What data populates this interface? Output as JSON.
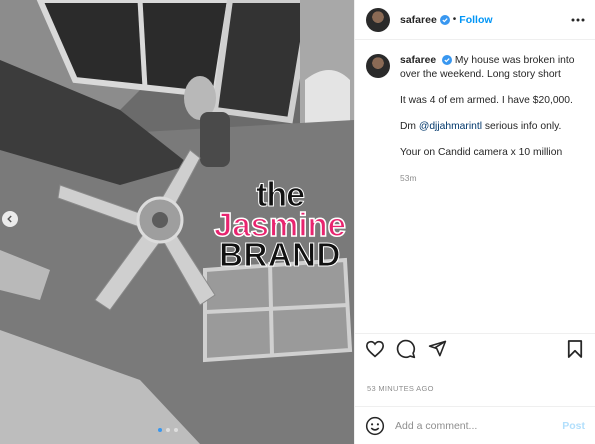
{
  "post": {
    "username": "safaree",
    "follow_label": "Follow",
    "separator": "•",
    "caption": {
      "username": "safaree",
      "lines": [
        "My house was broken into over the weekend. Long story short",
        "It was 4 of em armed. I have $20,000.",
        "Your on Candid camera x 10 million"
      ],
      "dm_prefix": "Dm ",
      "mention": "@djjahmarintl",
      "dm_suffix": " serious info only.",
      "age": "53m"
    },
    "timestamp": "53 MINUTES AGO",
    "comment_placeholder": "Add a comment...",
    "post_label": "Post"
  },
  "watermark": {
    "line1": "the",
    "line2": "Jasmine",
    "line3": "BRAND"
  },
  "carousel": {
    "count": 3,
    "active_index": 0
  },
  "colors": {
    "accent": "#0095f6",
    "watermark_pink": "#e8246f",
    "mention": "#00376b"
  },
  "icons": [
    "verified-badge-icon",
    "more-options-icon",
    "heart-icon",
    "comment-icon",
    "share-icon",
    "bookmark-icon",
    "emoji-icon",
    "chevron-left-icon"
  ]
}
